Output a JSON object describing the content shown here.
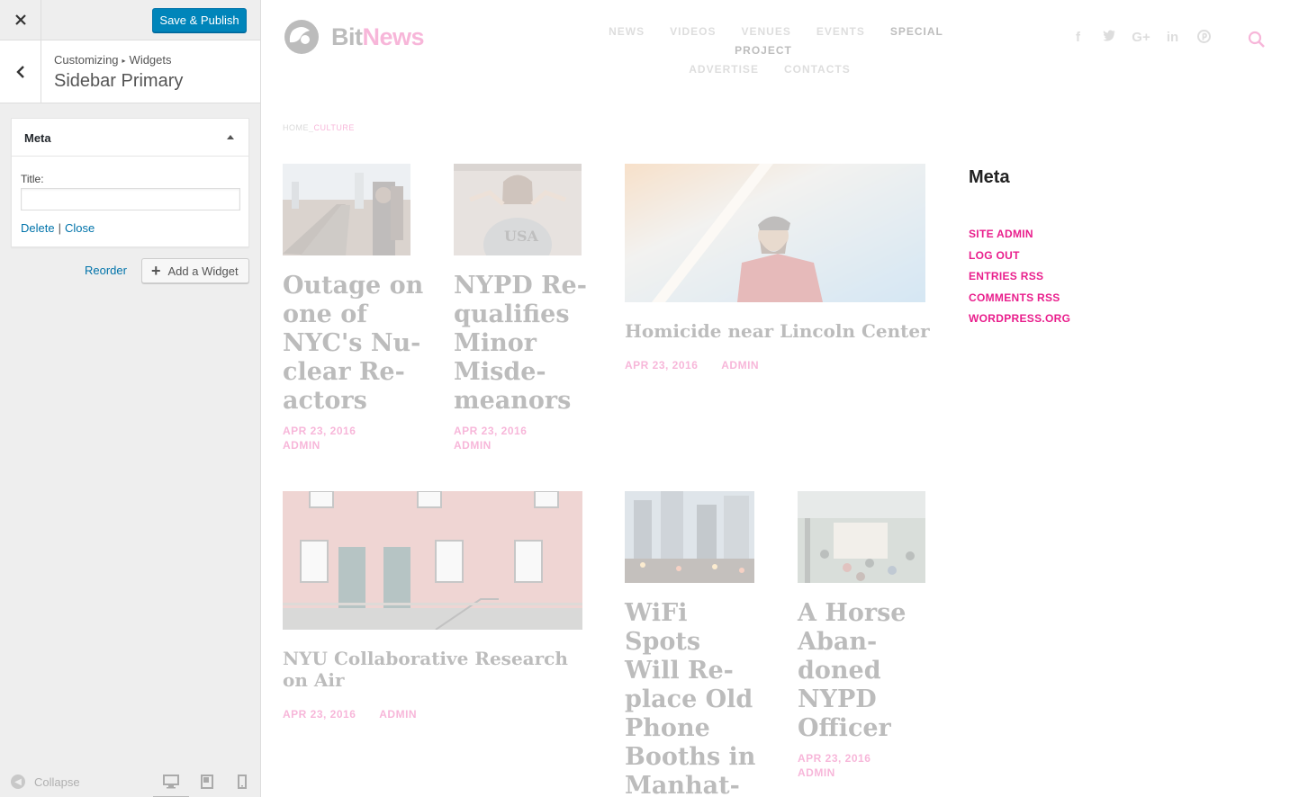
{
  "customizer": {
    "close_icon": "close-icon",
    "save_label": "Save & Publish",
    "breadcrumb_root": "Customizing",
    "breadcrumb_leaf": "Widgets",
    "section_title": "Sidebar Primary",
    "widget": {
      "name": "Meta",
      "title_label": "Title:",
      "title_value": "",
      "delete_label": "Delete",
      "separator": "|",
      "close_label": "Close"
    },
    "reorder_label": "Reorder",
    "add_widget_label": "Add a Widget",
    "collapse_label": "Collapse",
    "devices": [
      "desktop-icon",
      "tablet-icon",
      "mobile-icon"
    ],
    "colors": {
      "primary": "#0085ba",
      "link": "#0073aa",
      "panel_bg": "#eeeeee"
    }
  },
  "site": {
    "logo_bit": "Bit",
    "logo_news": "News",
    "nav": {
      "row1": [
        "NEWS",
        "VIDEOS",
        "VENUES",
        "EVENTS",
        "SPECIAL PROJECT"
      ],
      "row2": [
        "ADVERTISE",
        "CONTACTS"
      ]
    },
    "social": [
      "f",
      "t",
      "G+",
      "in",
      "p"
    ],
    "breadcrumb_home": "HOME",
    "breadcrumb_sep": "_",
    "breadcrumb_current": "CULTURE",
    "posts": [
      {
        "title": "Outage on one of NYC's Nu-clear Re-actors",
        "date": "APR 23, 2016",
        "author": "ADMIN"
      },
      {
        "title": "NYPD Re-qualifies Minor Misde-meanors",
        "date": "APR 23, 2016",
        "author": "ADMIN"
      },
      {
        "title": "Homicide near Lincoln Center",
        "date": "APR 23, 2016",
        "author": "ADMIN"
      },
      {
        "title": "NYU Collaborative Research on Air",
        "date": "APR 23, 2016",
        "author": "ADMIN"
      },
      {
        "title": "WiFi Spots Will Re-place Old Phone Booths in Manhat-tan",
        "date": "",
        "author": ""
      },
      {
        "title": "A Horse Aban-doned NYPD Officer",
        "date": "APR 23, 2016",
        "author": "ADMIN"
      }
    ],
    "sidebar_widget": {
      "title": "Meta",
      "links": [
        "SITE ADMIN",
        "LOG OUT",
        "ENTRIES RSS",
        "COMMENTS RSS",
        "WORDPRESS.ORG"
      ]
    },
    "colors": {
      "accent": "#e91e8c",
      "text": "#333333"
    }
  }
}
